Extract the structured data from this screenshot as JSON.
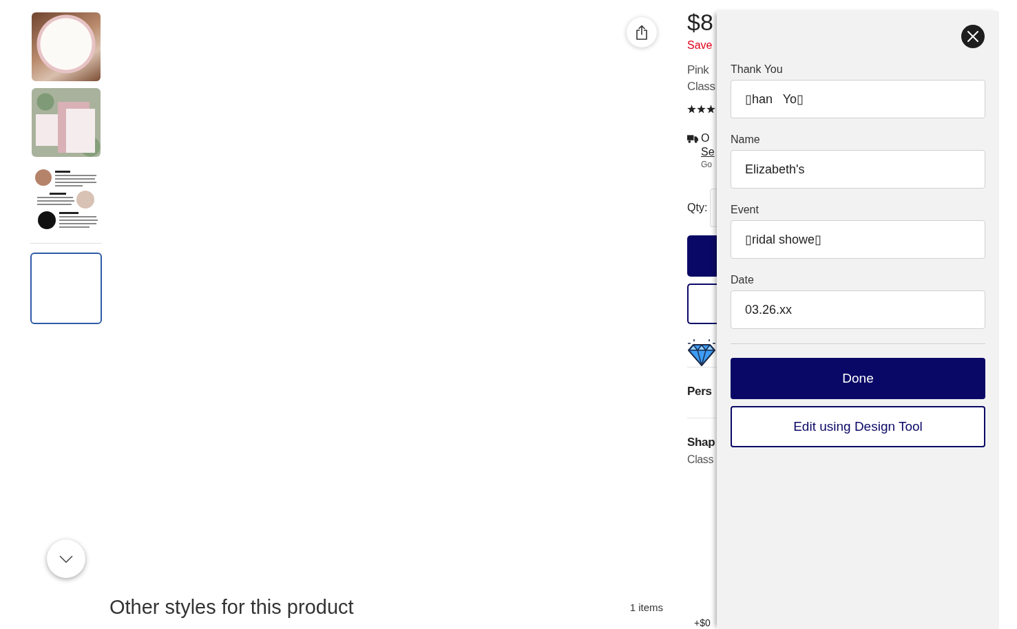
{
  "gallery": {
    "thumbnail_groups": [
      [
        {
          "kind": "sticker",
          "selected": false
        },
        {
          "kind": "cards",
          "selected": false
        },
        {
          "kind": "infographic",
          "selected": false
        }
      ],
      [
        {
          "kind": "blank",
          "selected": true
        }
      ]
    ]
  },
  "product": {
    "price": "$8",
    "savings": "Save",
    "title_lines": [
      "Pink",
      "Class"
    ],
    "stars": 3,
    "shipping": {
      "text": "O",
      "link": "Se",
      "note": "Go"
    },
    "qty_label": "Qty:",
    "action_buttons": [
      {
        "kind": "primary"
      },
      {
        "kind": "outline"
      }
    ],
    "sections": [
      {
        "title": "Pers"
      },
      {
        "title": "Shap",
        "value": "Class"
      }
    ],
    "footer_price": "+$0"
  },
  "panel": {
    "fields": [
      {
        "label": "Thank You",
        "value": "▯han   Yo▯"
      },
      {
        "label": "Name",
        "value": "Elizabeth's"
      },
      {
        "label": "Event",
        "value": "▯ridal showe▯"
      },
      {
        "label": "Date",
        "value": "03.26.xx"
      }
    ],
    "buttons": [
      {
        "kind": "primary",
        "label": "Done"
      },
      {
        "kind": "outline",
        "label": "Edit using Design Tool"
      }
    ]
  },
  "other_styles": {
    "title": "Other styles for this product",
    "count": "1 items"
  }
}
